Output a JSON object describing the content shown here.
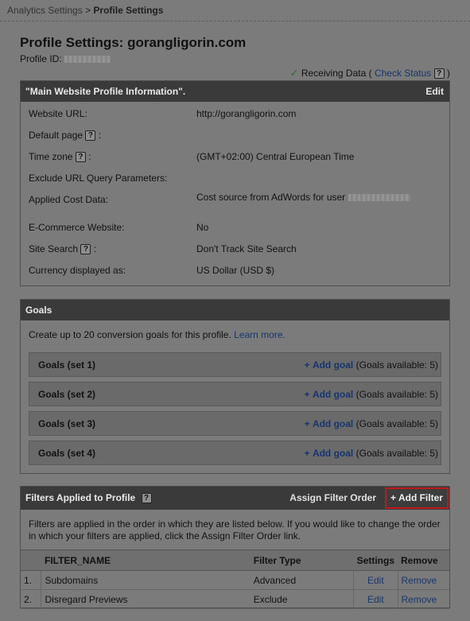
{
  "breadcrumb": {
    "parent": "Analytics Settings",
    "separator": ">",
    "current": "Profile Settings"
  },
  "title": "Profile Settings: gorangligorin.com",
  "profile_id_label": "Profile ID:",
  "status": {
    "check": "✓",
    "text": "Receiving Data (",
    "link": "Check Status",
    "help": "?",
    "close": ")"
  },
  "info_panel": {
    "title": "\"Main Website Profile Information\".",
    "edit": "Edit",
    "rows": [
      {
        "label": "Website URL:",
        "value": "http://gorangligorin.com"
      },
      {
        "label": "Default page",
        "help": "?",
        "suffix": ":",
        "value": ""
      },
      {
        "label": "Time zone",
        "help": "?",
        "suffix": ":",
        "value": "(GMT+02:00) Central European Time"
      },
      {
        "label": "Exclude URL Query Parameters:",
        "value": ""
      },
      {
        "label": "Applied Cost Data:",
        "value": "Cost source from AdWords for user"
      },
      {
        "label": "E-Commerce Website:",
        "value": "No"
      },
      {
        "label": "Site Search",
        "help": "?",
        "suffix": ":",
        "value": "Don't Track Site Search"
      },
      {
        "label": "Currency displayed as:",
        "value": "US Dollar (USD $)"
      }
    ]
  },
  "goals_panel": {
    "title": "Goals",
    "desc": "Create up to 20 conversion goals for this profile.",
    "learn_more": "Learn more.",
    "add_plus": "+",
    "add_label": "Add goal",
    "sets": [
      {
        "name": "Goals (set 1)",
        "available": "(Goals available: 5)"
      },
      {
        "name": "Goals (set 2)",
        "available": "(Goals available: 5)"
      },
      {
        "name": "Goals (set 3)",
        "available": "(Goals available: 5)"
      },
      {
        "name": "Goals (set 4)",
        "available": "(Goals available: 5)"
      }
    ]
  },
  "filters_panel": {
    "title": "Filters Applied to Profile",
    "help": "?",
    "assign": "Assign Filter Order",
    "add_filter": "+ Add Filter",
    "desc": "Filters are applied in the order in which they are listed below. If you would like to change the order in which your filters are applied, click the Assign Filter Order link.",
    "columns": [
      "FILTER_NAME",
      "Filter Type",
      "Settings",
      "Remove"
    ],
    "rows": [
      {
        "num": "1.",
        "name": "Subdomains",
        "type": "Advanced",
        "settings": "Edit",
        "remove": "Remove"
      },
      {
        "num": "2.",
        "name": "Disregard Previews",
        "type": "Exclude",
        "settings": "Edit",
        "remove": "Remove"
      }
    ]
  }
}
